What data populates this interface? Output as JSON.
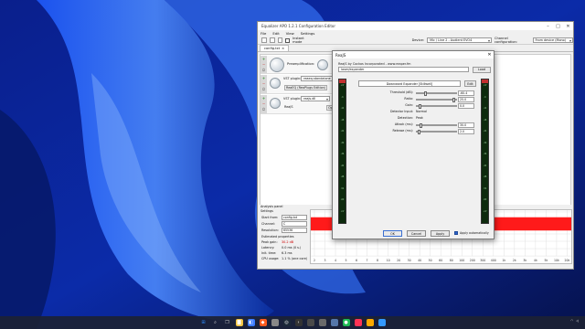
{
  "apo": {
    "title": "Equalizer APO 1.2.1 Configuration Editor",
    "menu": [
      "File",
      "Edit",
      "View",
      "Settings"
    ],
    "instant_mode_label": "Instant mode",
    "device_label": "Device:",
    "device_value": "Mic / Line 2 - Audient EVO4",
    "channel_config_label": "Channel configuration:",
    "channel_config_value": "From device (Mono)",
    "tab_label": "config.txt",
    "preamp_label": "Preamplification:",
    "vst1_label": "VST plugin:",
    "vst1_value": "reaeq-standalone",
    "vst1_button": "ReaEQ (ReaPlugs Edition)",
    "vst2_label": "VST plugin:",
    "vst2_value": "reajs.dll",
    "vst2_button": "ReaJS",
    "vst2_open": "Op",
    "analysis": {
      "title": "Analysis panel",
      "settings_label": "Settings",
      "start_from_label": "Start from:",
      "start_from_value": "config.txt",
      "channel_label": "Channel:",
      "channel_value": "C",
      "resolution_label": "Resolution:",
      "resolution_value": "65536",
      "estimated_label": "Estimated properties",
      "peak_gain_label": "Peak gain:",
      "peak_gain_value": "30.2 dB",
      "latency_label": "Latency:",
      "latency_value": "0.0 ms (0 s.)",
      "init_time_label": "Init. time:",
      "init_time_value": "6.3 ms",
      "cpu_label": "CPU usage:",
      "cpu_value": "1.1 % (one core)",
      "freq_ticks": [
        "2",
        "3",
        "4",
        "5",
        "6",
        "7",
        "8",
        "10",
        "20",
        "30",
        "40",
        "50",
        "60",
        "80",
        "100",
        "200",
        "300",
        "400",
        "1k",
        "2k",
        "3k",
        "4k",
        "5k",
        "10k",
        "20k"
      ]
    }
  },
  "rea": {
    "title": "ReaJS",
    "credit": "ReaJS by Cockos Incorporated - www.reaper.fm",
    "preset": "loser/expander",
    "load_label": "Load",
    "effect_name": "Downward Expander [Stillwell]",
    "edit_label": "Edit",
    "params": [
      {
        "label": "Threshold (dB):",
        "value": "-60.4",
        "pos": 0.2
      },
      {
        "label": "Ratio:",
        "value": "25.0",
        "pos": 0.92
      },
      {
        "label": "Gain:",
        "value": "0.0",
        "pos": 0.05
      },
      {
        "label": "Detector Input:",
        "text": "Normal"
      },
      {
        "label": "Detection:",
        "text": "Peak"
      },
      {
        "label": "Attack (ms):",
        "value": "30.0",
        "pos": 0.08
      },
      {
        "label": "Release (ms):",
        "value": "2.0",
        "pos": 0.02
      }
    ],
    "meter_ticks": [
      "-inf",
      "-6",
      "-12",
      "-18",
      "-24",
      "-30",
      "-36",
      "-42",
      "-48",
      "-54",
      "-60",
      "-inf"
    ],
    "ok_label": "OK",
    "cancel_label": "Cancel",
    "apply_label": "Apply",
    "auto_apply_label": "Apply automatically"
  },
  "taskbar": {
    "icons": [
      "windows-icon",
      "search-icon",
      "task-view-icon",
      "explorer-icon",
      "store-icon",
      "brave-icon",
      "app-icon",
      "steam-icon",
      "terminal-icon",
      "app2-icon",
      "app3-icon",
      "app4-icon",
      "spotify-icon",
      "app5-icon",
      "app6-icon",
      "app7-icon"
    ],
    "tray_time": "",
    "tray_date": ""
  },
  "colors": {
    "accent": "#2d63c8",
    "graph_fill": "#ff1a1a",
    "meter_bg": "#0d2a0d",
    "meter_cap": "#c23030"
  }
}
